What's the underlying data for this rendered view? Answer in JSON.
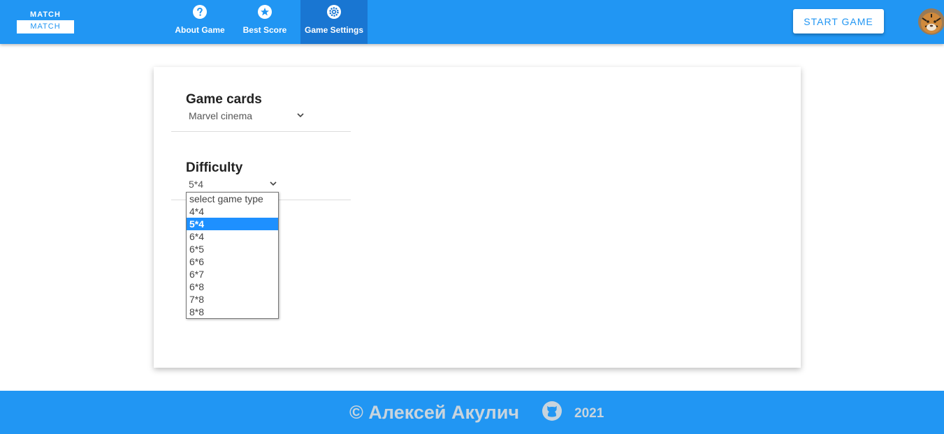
{
  "header": {
    "logo": {
      "top": "MATCH",
      "bottom": "MATCH"
    },
    "nav": [
      {
        "label": "About Game",
        "icon": "help-circle-icon"
      },
      {
        "label": "Best Score",
        "icon": "star-circle-icon"
      },
      {
        "label": "Game Settings",
        "icon": "gear-icon",
        "active": true
      }
    ],
    "start_label": "START GAME"
  },
  "settings": {
    "cards": {
      "title": "Game cards",
      "value": "Marvel cinema"
    },
    "difficulty": {
      "title": "Difficulty",
      "value": "5*4",
      "options": [
        "select game type",
        "4*4",
        "5*4",
        "6*4",
        "6*5",
        "6*6",
        "6*7",
        "6*8",
        "7*8",
        "8*8"
      ],
      "selected": "5*4"
    }
  },
  "footer": {
    "author": "© Алексей Акулич",
    "icon": "github-icon",
    "year": "2021"
  },
  "colors": {
    "primary": "#2196f3",
    "active_tab": "#1976d2",
    "option_highlight": "#1e90ff",
    "footer_text": "#c8d4dd"
  }
}
